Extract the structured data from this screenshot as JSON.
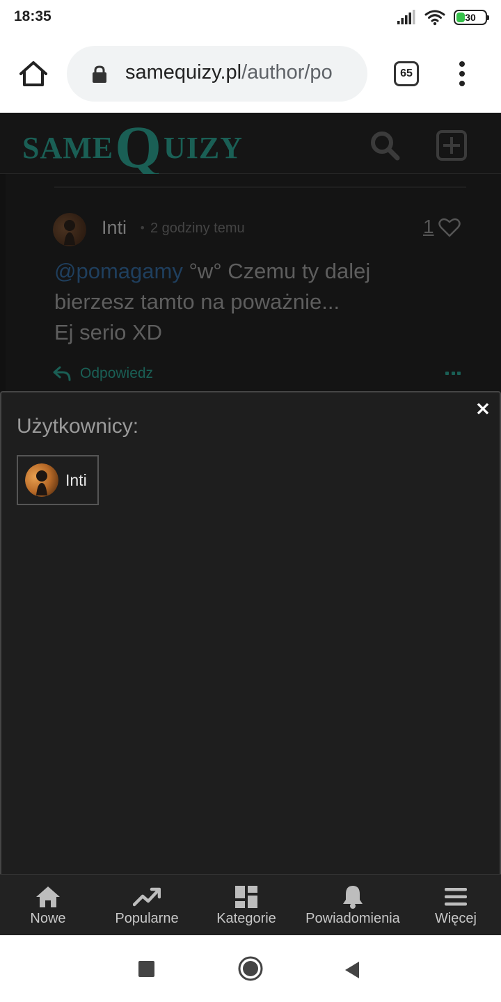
{
  "status_bar": {
    "time": "18:35",
    "battery_level": "30",
    "battery_fraction": 0.3,
    "icons": [
      "signal-icon",
      "wifi-icon",
      "battery-icon"
    ]
  },
  "browser": {
    "url_domain": "samequizy.pl",
    "url_path": "/author/po",
    "tab_count": "65",
    "icons": [
      "home-icon",
      "lock-icon",
      "tabs-icon",
      "overflow-menu-icon"
    ]
  },
  "site": {
    "logo_parts": [
      "SAME",
      "Q",
      "UIZY"
    ],
    "brand_color": "#1a5f55",
    "header_icons": [
      "search-icon",
      "add-icon"
    ]
  },
  "comment": {
    "author": "Inti",
    "separator": "•",
    "time": "2 godziny temu",
    "likes": "1",
    "mention": "@pomagamy",
    "text_line1": " °w° Czemu ty dalej",
    "text_line2": "bierzesz tamto na poważnie...",
    "text_line3": "Ej serio XD",
    "reply_label": "Odpowiedz"
  },
  "modal": {
    "title": "Użytkownicy:",
    "close_label": "×",
    "users": [
      {
        "name": "Inti"
      }
    ]
  },
  "bottom_nav": {
    "items": [
      {
        "label": "Nowe",
        "icon": "home-icon"
      },
      {
        "label": "Popularne",
        "icon": "trending-icon"
      },
      {
        "label": "Kategorie",
        "icon": "categories-icon"
      },
      {
        "label": "Powiadomienia",
        "icon": "bell-icon"
      },
      {
        "label": "Więcej",
        "icon": "hamburger-icon"
      }
    ]
  },
  "android_nav": {
    "icons": [
      "recents-icon",
      "home-circle-icon",
      "back-icon"
    ]
  }
}
